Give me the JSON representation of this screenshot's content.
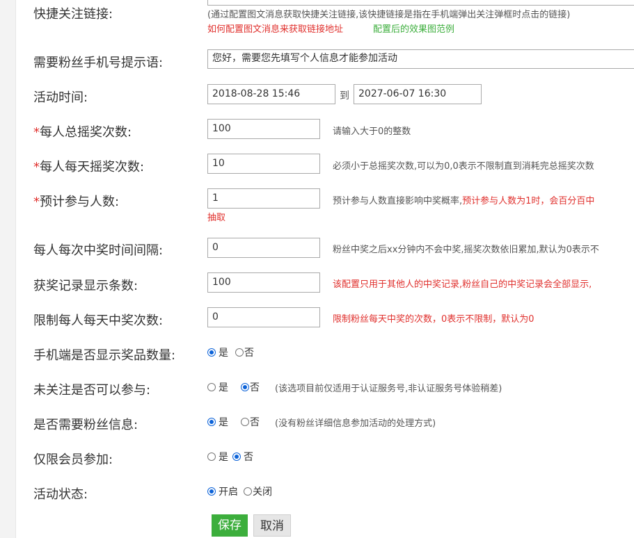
{
  "shortcut": {
    "label": "快捷关注链接:",
    "note": "(通过配置图文消息获取快捷关注链接,该快捷链接是指在手机端弹出关注弹框时点击的链接)",
    "link_howto": "如何配置图文消息来获取链接地址",
    "link_example": "配置后的效果图范例"
  },
  "phone_prompt": {
    "label": "需要粉丝手机号提示语:",
    "value": "您好，需要您先填写个人信息才能参加活动"
  },
  "activity_time": {
    "label": "活动时间:",
    "start": "2018-08-28 15:46",
    "to": "到",
    "end": "2027-06-07 16:30"
  },
  "total_shakes": {
    "req": "*",
    "label": "每人总摇奖次数:",
    "value": "100",
    "hint": "请输入大于0的整数"
  },
  "daily_shakes": {
    "req": "*",
    "label": "每人每天摇奖次数:",
    "value": "10",
    "hint": "必须小于总摇奖次数,可以为0,0表示不限制直到消耗完总摇奖次数"
  },
  "expected_participants": {
    "req": "*",
    "label": "预计参与人数:",
    "value": "1",
    "hint": "预计参与人数直接影响中奖概率,",
    "hint_red": "预计参与人数为1时，会百分百中",
    "hint_wrap": "抽取"
  },
  "win_interval": {
    "label": "每人每次中奖时间间隔:",
    "value": "0",
    "hint": "粉丝中奖之后xx分钟内不会中奖,摇奖次数依旧累加,默认为0表示不"
  },
  "record_count": {
    "label": "获奖记录显示条数:",
    "value": "100",
    "hint": "该配置只用于其他人的中奖记录,粉丝自己的中奖记录会全部显示,"
  },
  "daily_wins": {
    "label": "限制每人每天中奖次数:",
    "value": "0",
    "hint": "限制粉丝每天中奖的次数，0表示不限制，默认为0"
  },
  "show_prize_count": {
    "label": "手机端是否显示奖品数量:",
    "yes": "是",
    "no": "否"
  },
  "unfollowed_join": {
    "label": "未关注是否可以参与:",
    "yes": "是",
    "no": "否",
    "note": "(该选项目前仅适用于认证服务号,非认证服务号体验稍差)"
  },
  "need_fan_info": {
    "label": "是否需要粉丝信息:",
    "yes": "是",
    "no": "否",
    "note": "(没有粉丝详细信息参加活动的处理方式)"
  },
  "members_only": {
    "label": "仅限会员参加:",
    "yes": "是",
    "no": "否"
  },
  "status": {
    "label": "活动状态:",
    "on": "开启",
    "off": "关闭"
  },
  "buttons": {
    "save": "保存",
    "cancel": "取消"
  }
}
